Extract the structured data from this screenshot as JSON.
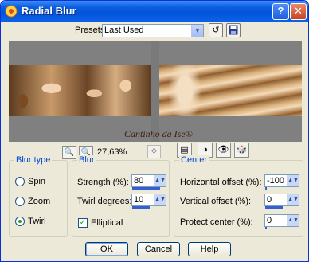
{
  "window": {
    "title": "Radial Blur",
    "help_label": "?",
    "close_label": "✕"
  },
  "presets": {
    "label": "Presets:",
    "value": "Last Used"
  },
  "preview": {
    "watermark": "Cantinho da Ise®"
  },
  "zoom": {
    "value": "27,63%"
  },
  "blur_type": {
    "legend": "Blur type",
    "options": [
      "Spin",
      "Zoom",
      "Twirl"
    ],
    "selected": "Twirl"
  },
  "blur": {
    "legend": "Blur",
    "strength_label": "Strength (%):",
    "strength_value": "80",
    "twirl_label": "Twirl degrees:",
    "twirl_value": "10",
    "elliptical_label": "Elliptical",
    "elliptical_checked": true
  },
  "center": {
    "legend": "Center",
    "h_offset_label": "Horizontal offset (%):",
    "h_offset_value": "-100",
    "v_offset_label": "Vertical offset (%):",
    "v_offset_value": "0",
    "protect_label": "Protect center (%):",
    "protect_value": "0"
  },
  "buttons": {
    "ok": "OK",
    "cancel": "Cancel",
    "help": "Help"
  }
}
